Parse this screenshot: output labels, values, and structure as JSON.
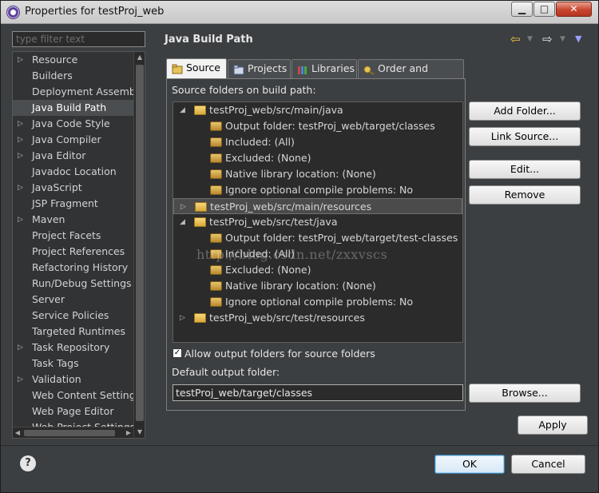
{
  "window": {
    "title": "Properties for testProj_web",
    "min_glyph": "▁",
    "max_glyph": "□",
    "close_glyph": "✕"
  },
  "filter": {
    "placeholder": "type filter text"
  },
  "nav": {
    "items": [
      {
        "label": "Resource",
        "expandable": true
      },
      {
        "label": "Builders",
        "expandable": false
      },
      {
        "label": "Deployment Assembly",
        "expandable": false
      },
      {
        "label": "Java Build Path",
        "expandable": false,
        "selected": true
      },
      {
        "label": "Java Code Style",
        "expandable": true
      },
      {
        "label": "Java Compiler",
        "expandable": true
      },
      {
        "label": "Java Editor",
        "expandable": true
      },
      {
        "label": "Javadoc Location",
        "expandable": false
      },
      {
        "label": "JavaScript",
        "expandable": true
      },
      {
        "label": "JSP Fragment",
        "expandable": false
      },
      {
        "label": "Maven",
        "expandable": true
      },
      {
        "label": "Project Facets",
        "expandable": false
      },
      {
        "label": "Project References",
        "expandable": false
      },
      {
        "label": "Refactoring History",
        "expandable": false
      },
      {
        "label": "Run/Debug Settings",
        "expandable": false
      },
      {
        "label": "Server",
        "expandable": false
      },
      {
        "label": "Service Policies",
        "expandable": false
      },
      {
        "label": "Targeted Runtimes",
        "expandable": false
      },
      {
        "label": "Task Repository",
        "expandable": true
      },
      {
        "label": "Task Tags",
        "expandable": false
      },
      {
        "label": "Validation",
        "expandable": true
      },
      {
        "label": "Web Content Settings",
        "expandable": false
      },
      {
        "label": "Web Page Editor",
        "expandable": false
      },
      {
        "label": "Web Project Settings",
        "expandable": false
      }
    ]
  },
  "header": {
    "title": "Java Build Path",
    "back_glyph": "⇦",
    "forward_glyph": "⇨",
    "dropdown_glyph": "▼"
  },
  "tabs": [
    {
      "label": "Source",
      "active": true
    },
    {
      "label": "Projects",
      "active": false
    },
    {
      "label": "Libraries",
      "active": false
    },
    {
      "label": "Order and Export",
      "active": false
    }
  ],
  "source": {
    "section_label": "Source folders on build path:",
    "tree": [
      {
        "label": "testProj_web/src/main/java",
        "kind": "folder",
        "level": 0,
        "arrow": "◢"
      },
      {
        "label": "Output folder: testProj_web/target/classes",
        "kind": "attr",
        "level": 1
      },
      {
        "label": "Included: (All)",
        "kind": "attr",
        "level": 1
      },
      {
        "label": "Excluded: (None)",
        "kind": "attr",
        "level": 1
      },
      {
        "label": "Native library location: (None)",
        "kind": "attr",
        "level": 1
      },
      {
        "label": "Ignore optional compile problems: No",
        "kind": "attr",
        "level": 1
      },
      {
        "label": "testProj_web/src/main/resources",
        "kind": "folder",
        "level": 0,
        "arrow": "▷",
        "selected": true
      },
      {
        "label": "testProj_web/src/test/java",
        "kind": "folder",
        "level": 0,
        "arrow": "◢"
      },
      {
        "label": "Output folder: testProj_web/target/test-classes",
        "kind": "attr",
        "level": 1
      },
      {
        "label": "Included: (All)",
        "kind": "attr",
        "level": 1
      },
      {
        "label": "Excluded: (None)",
        "kind": "attr",
        "level": 1
      },
      {
        "label": "Native library location: (None)",
        "kind": "attr",
        "level": 1
      },
      {
        "label": "Ignore optional compile problems: No",
        "kind": "attr",
        "level": 1
      },
      {
        "label": "testProj_web/src/test/resources",
        "kind": "folder",
        "level": 0,
        "arrow": "▷"
      }
    ],
    "buttons": {
      "add_folder": "Add Folder...",
      "link_source": "Link Source...",
      "edit": "Edit...",
      "remove": "Remove"
    },
    "allow_output_label": "Allow output folders for source folders",
    "allow_output_checked": true,
    "default_output_label": "Default output folder:",
    "default_output_value": "testProj_web/target/classes",
    "browse": "Browse..."
  },
  "watermark": "http://blog.csdn.net/zxxvscs",
  "footer": {
    "apply": "Apply",
    "ok": "OK",
    "cancel": "Cancel",
    "help_glyph": "?"
  }
}
